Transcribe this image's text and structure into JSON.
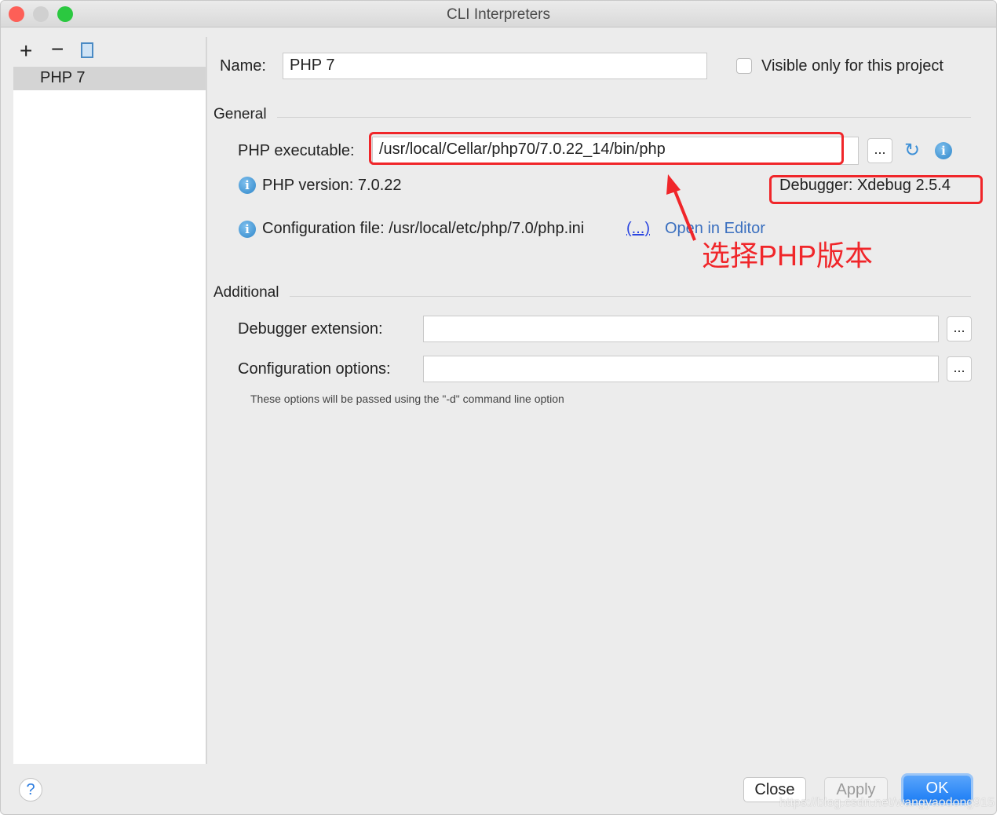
{
  "window": {
    "title": "CLI Interpreters"
  },
  "sidebar": {
    "items": [
      {
        "label": "PHP 7"
      }
    ]
  },
  "form": {
    "name_label": "Name:",
    "name_value": "PHP 7",
    "visible_only_label": "Visible only for this project",
    "visible_only_checked": false,
    "general_label": "General",
    "php_exec_label": "PHP executable:",
    "php_exec_value": "/usr/local/Cellar/php70/7.0.22_14/bin/php",
    "browse_label": "...",
    "php_version": "PHP version: 7.0.22",
    "debugger": "Debugger: Xdebug 2.5.4",
    "config_file": "Configuration file: /usr/local/etc/php/7.0/php.ini",
    "config_link": "(...)",
    "open_in_editor": "Open in Editor",
    "additional_label": "Additional",
    "debugger_ext_label": "Debugger extension:",
    "debugger_ext_value": "",
    "config_opts_label": "Configuration options:",
    "config_opts_value": "",
    "hint": "These options will be passed using the \"-d\" command line option"
  },
  "annotation": {
    "text": "选择PHP版本",
    "color": "#f0262a"
  },
  "footer": {
    "help": "?",
    "close": "Close",
    "apply": "Apply",
    "ok": "OK",
    "accent": "#1a7cf5"
  },
  "watermark": "https://blog.csdn.net/wangyaodong915"
}
